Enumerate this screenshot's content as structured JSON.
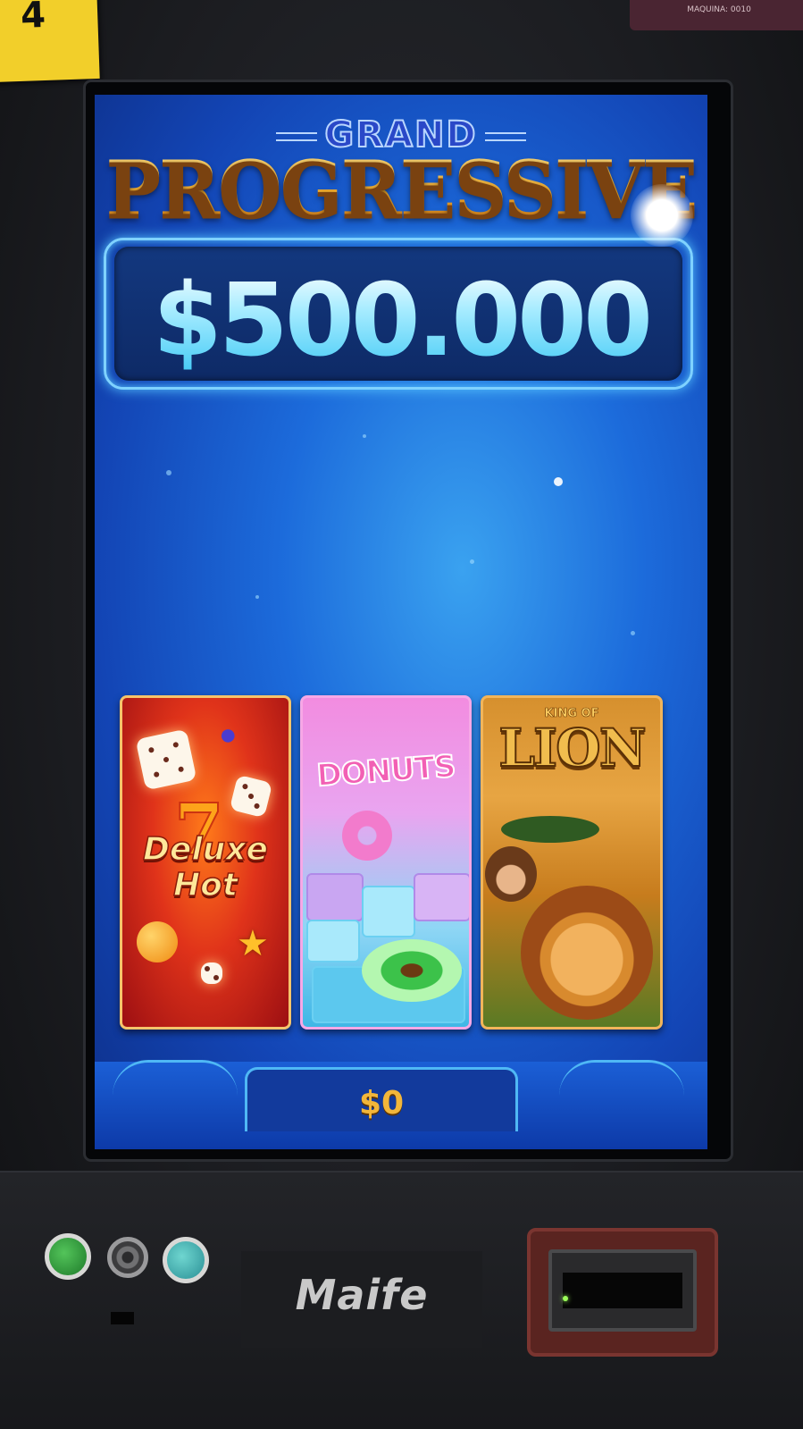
{
  "corner_note": {
    "text": "4"
  },
  "machine_tag": {
    "text": "MAQUINA: 0010"
  },
  "jackpot": {
    "grand_label": "GRAND",
    "title": "PROGRESSIVE",
    "amount": "$500.000"
  },
  "games": [
    {
      "title_line1": "Deluxe",
      "title_line2": "Hot"
    },
    {
      "title": "DONUTS"
    },
    {
      "title_small": "KING OF",
      "title": "LION"
    }
  ],
  "credit": {
    "value": "$0"
  },
  "panel": {
    "brand": "Maife"
  },
  "colors": {
    "screen_blue": "#1c6bdb",
    "gold": "#f3b53a",
    "jackpot_cyan": "#a8ecff",
    "bill_acceptor": "#5a2420"
  }
}
